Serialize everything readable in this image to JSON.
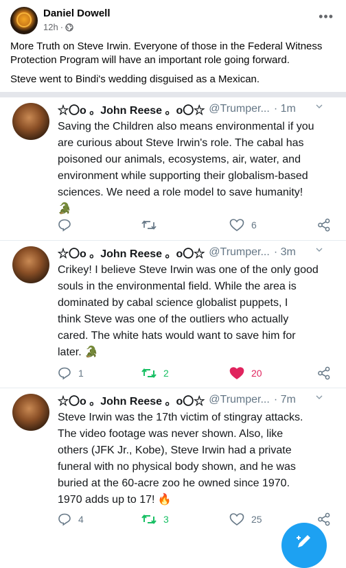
{
  "facebook_post": {
    "author": "Daniel Dowell",
    "time": "12h",
    "line1": "More Truth on Steve Irwin. Everyone of those in the Federal Witness",
    "line2": "Protection Program will have an important role going forward.",
    "line3": "Steve went to Bindi's wedding disguised as a Mexican.",
    "more_label": "•••"
  },
  "tweets": [
    {
      "name": "☆〇o 。John Reese 。o〇☆",
      "handle": "@Trumper...",
      "time": "· 1m",
      "lines": [
        "Saving the Children also means environmental if you",
        "are curious about Steve Irwin's role. The cabal has",
        "poisoned our animals, ecosystems, air, water, and",
        "environment while supporting their globalism-based",
        "sciences. We need a role model to save humanity!"
      ],
      "emoji": "🐊",
      "replies": "",
      "retweets": "",
      "likes": "6"
    },
    {
      "name": "☆〇o 。John Reese 。o〇☆",
      "handle": "@Trumper...",
      "time": "· 3m",
      "lines": [
        "Crikey! I believe Steve Irwin was one of the only good",
        "souls in the environmental field. While the area is",
        "dominated by cabal science globalist puppets, I",
        "think Steve was one of the outliers who actually",
        "cared. The white hats would want to save him for"
      ],
      "last_line": "later.",
      "emoji": "🐊",
      "replies": "1",
      "retweets": "2",
      "likes": "20"
    },
    {
      "name": "☆〇o 。John Reese 。o〇☆",
      "handle": "@Trumper...",
      "time": "· 7m",
      "lines": [
        "Steve Irwin was the 17th victim of stingray attacks.",
        "The video footage was never shown. Also, like",
        "others (JFK Jr., Kobe), Steve Irwin had a private",
        "funeral with no physical body shown, and he was",
        "buried at the 60-acre zoo he owned since 1970."
      ],
      "last_line": "1970 adds up to 17!",
      "emoji": "🔥",
      "replies": "4",
      "retweets": "3",
      "likes": "25"
    }
  ],
  "colors": {
    "twitter_blue": "#1da1f2",
    "retweet_green": "#17bf63",
    "like_red": "#e0245e",
    "icon_gray": "#657786"
  },
  "icons": {
    "reply": "reply-icon",
    "retweet": "retweet-icon",
    "like": "heart-icon",
    "share": "share-icon",
    "compose": "compose-icon"
  }
}
